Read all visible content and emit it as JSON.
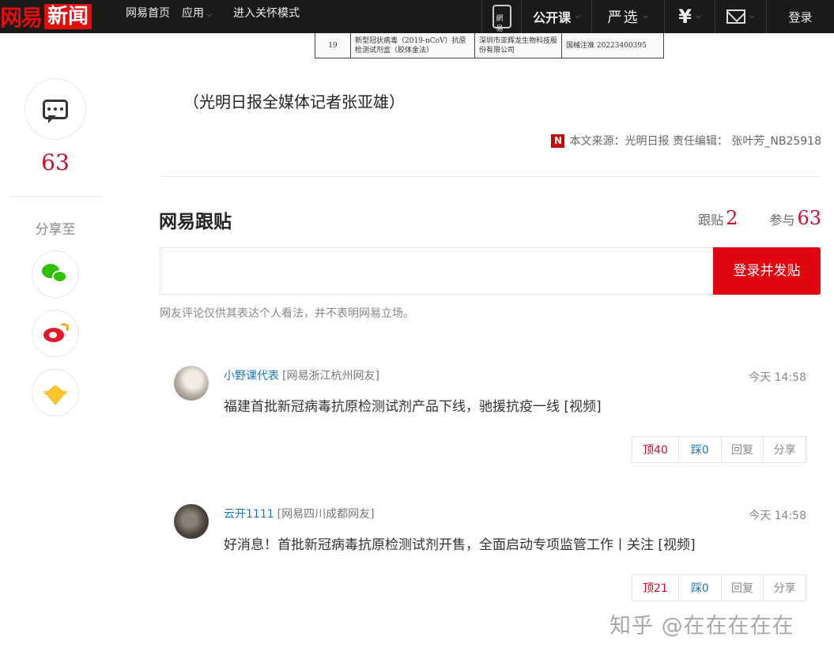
{
  "topbar": {
    "logo_text_a": "网易",
    "logo_text_b": "新闻",
    "nav": {
      "home": "网易首页",
      "apps": "应用",
      "care_mode": "进入关怀模式"
    },
    "right": {
      "phone_label": "網易",
      "open_course": "公开课",
      "yanxuan": "严选",
      "yuan": "¥",
      "login": "登录"
    }
  },
  "article_image": {
    "row_no": "19",
    "col2": "新型冠状病毒（2019-nCoV）抗原检测试剂盒（胶体金法）",
    "col3": "深圳市亚辉龙生物科技股份有限公司",
    "col4": "国械注准 20223400395"
  },
  "sidebar": {
    "comment_count": "63",
    "share_to": "分享至"
  },
  "article": {
    "byline": "（光明日报全媒体记者张亚雄）",
    "source_icon": "N",
    "source": "本文来源：光明日报 责任编辑： 张叶芳_NB25918"
  },
  "comments": {
    "title": "网易跟贴",
    "follow_label": "跟贴",
    "follow_count": "2",
    "participate_label": "参与",
    "participate_count": "63",
    "submit_label": "登录并发贴",
    "note": "网友评论仅供其表达个人看法，并不表明网易立场。",
    "items": [
      {
        "user": "小野课代表",
        "location": "[网易浙江杭州网友]",
        "time": "今天 14:58",
        "text": "福建首批新冠病毒抗原检测试剂产品下线，驰援抗疫一线 [视频]",
        "up_label": "顶40",
        "down_label": "踩0",
        "reply_label": "回复",
        "share_label": "分享"
      },
      {
        "user": "云开1111",
        "location": "[网易四川成都网友]",
        "time": "今天 14:58",
        "text": "好消息！首批新冠病毒抗原检测试剂开售，全面启动专项监管工作丨关注 [视频]",
        "up_label": "顶21",
        "down_label": "踩0",
        "reply_label": "回复",
        "share_label": "分享"
      }
    ]
  },
  "watermark": "知乎 @在在在在在",
  "icons": {
    "comment": "comment-bubble-icon",
    "wechat": "wechat-icon",
    "weibo": "weibo-icon",
    "qzone": "qzone-star-icon",
    "mail": "mail-icon",
    "phone": "phone-icon"
  },
  "colors": {
    "brand_red": "#e0060f",
    "count_red": "#c8102e",
    "link_blue": "#1b78c0",
    "topbar_bg": "#1a1a1a"
  }
}
